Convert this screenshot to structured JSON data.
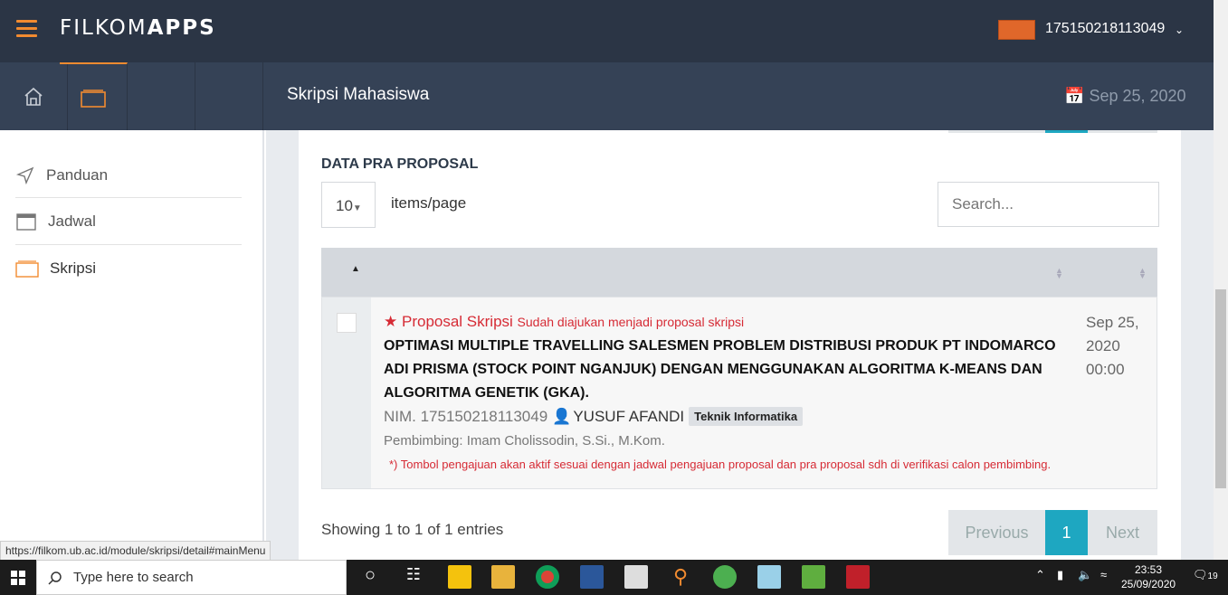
{
  "header": {
    "logo_light": "FILKOM",
    "logo_bold": "APPS",
    "user_id": "175150218113049"
  },
  "subheader": {
    "page_title": "Skripsi Mahasiswa",
    "date": "Sep 25, 2020"
  },
  "sidebar": {
    "items": [
      {
        "label": "Panduan",
        "icon": "send-icon"
      },
      {
        "label": "Jadwal",
        "icon": "calendar-icon"
      },
      {
        "label": "Skripsi",
        "icon": "folder-icon"
      }
    ]
  },
  "main": {
    "section_title": "DATA PRA PROPOSAL",
    "per_page_value": "10",
    "items_per_page_label": "items/page",
    "search_placeholder": "Search...",
    "row": {
      "type_label": "Proposal Skripsi",
      "status_text": "Sudah diajukan menjadi proposal skripsi",
      "title": "OPTIMASI MULTIPLE TRAVELLING SALESMEN PROBLEM DISTRIBUSI PRODUK PT INDOMARCO ADI PRISMA (STOCK POINT NGANJUK) DENGAN MENGGUNAKAN ALGORITMA K-MEANS DAN ALGORITMA GENETIK (GKA).",
      "nim": "NIM. 175150218113049",
      "student_name": "YUSUF AFANDI",
      "program_badge": "Teknik Informatika",
      "supervisor": "Pembimbing: Imam Cholissodin, S.Si., M.Kom.",
      "note": "*) Tombol pengajuan akan aktif sesuai dengan jadwal pengajuan proposal dan pra proposal sdh di verifikasi calon pembimbing.",
      "date_line1": "Sep 25,",
      "date_line2": "2020",
      "date_line3": "00:00"
    },
    "showing_text": "Showing 1 to 1 of 1 entries",
    "pagination": {
      "previous": "Previous",
      "current": "1",
      "next": "Next"
    }
  },
  "status_url": "https://filkom.ub.ac.id/module/skripsi/detail#mainMenu",
  "taskbar": {
    "search_placeholder": "Type here to search",
    "time": "23:53",
    "date": "25/09/2020",
    "notifications": "19"
  },
  "colors": {
    "topbar": "#2b3545",
    "subbar": "#354256",
    "accent": "#f28b30",
    "danger": "#d62b35",
    "pager_active": "#1ea7c1"
  }
}
